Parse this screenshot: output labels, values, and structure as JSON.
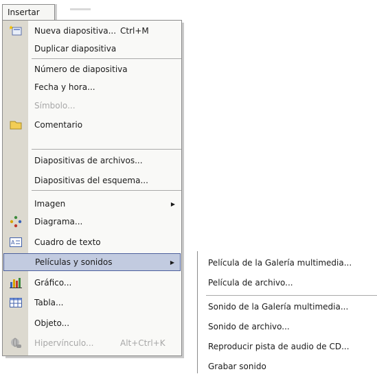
{
  "menubar": {
    "insert_label": "Insertar"
  },
  "menu": {
    "items": [
      {
        "label": "Nueva diapositiva...",
        "shortcut": "Ctrl+M",
        "icon": "new-slide-icon"
      },
      {
        "label": "Duplicar diapositiva"
      },
      {
        "label": "Número de diapositiva"
      },
      {
        "label": "Fecha y hora..."
      },
      {
        "label": "Símbolo..."
      },
      {
        "label": "Comentario",
        "icon": "comment-icon"
      },
      {
        "label": "Diapositivas de archivos..."
      },
      {
        "label": "Diapositivas del esquema..."
      },
      {
        "label": "Imagen"
      },
      {
        "label": "Diagrama...",
        "icon": "diagram-icon"
      },
      {
        "label": "Cuadro de texto",
        "icon": "textbox-icon"
      },
      {
        "label": "Películas y sonidos"
      },
      {
        "label": "Gráfico...",
        "icon": "chart-icon"
      },
      {
        "label": "Tabla...",
        "icon": "table-icon"
      },
      {
        "label": "Objeto..."
      },
      {
        "label": "Hipervínculo...",
        "shortcut": "Alt+Ctrl+K",
        "icon": "hyperlink-icon"
      }
    ]
  },
  "submenu": {
    "items": [
      {
        "label": "Película de la Galería multimedia..."
      },
      {
        "label": "Película de archivo..."
      },
      {
        "label": "Sonido de la Galería multimedia..."
      },
      {
        "label": "Sonido de archivo..."
      },
      {
        "label": "Reproducir pista de audio de CD..."
      },
      {
        "label": "Grabar sonido"
      }
    ]
  }
}
